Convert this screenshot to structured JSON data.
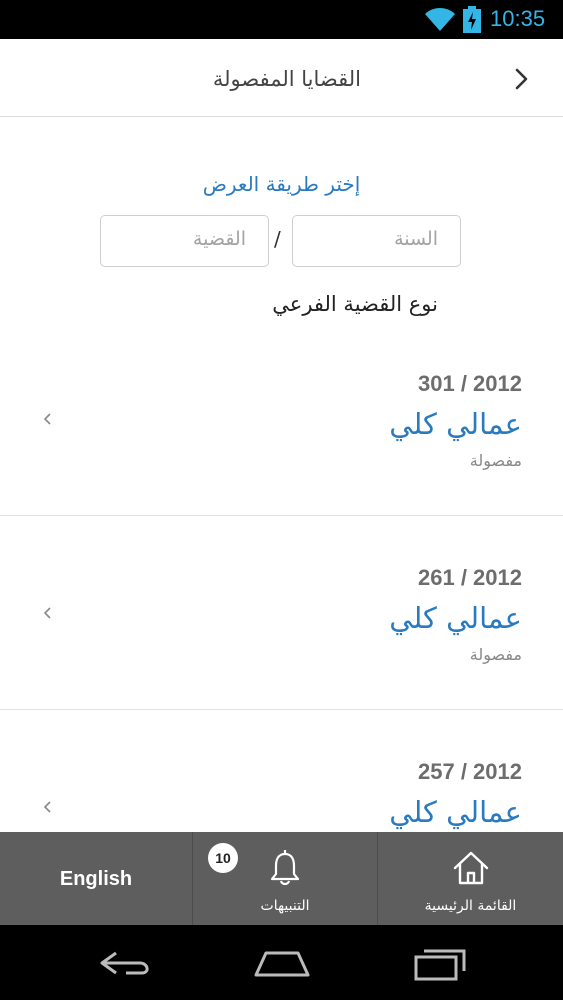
{
  "status_bar": {
    "time": "10:35"
  },
  "header": {
    "title": "القضايا المفصولة"
  },
  "filter": {
    "title": "إختر طريقة العرض",
    "year_placeholder": "السنة",
    "separator": "/",
    "case_placeholder": "القضية",
    "subtype_value": "نوع القضية الفرعي"
  },
  "cases": [
    {
      "number": "301 / 2012",
      "type": "عمالي كلي",
      "status": "مفصولة"
    },
    {
      "number": "261 / 2012",
      "type": "عمالي كلي",
      "status": "مفصولة"
    },
    {
      "number": "257 / 2012",
      "type": "عمالي كلي",
      "status": ""
    }
  ],
  "bottom_nav": {
    "home_label": "القائمة الرئيسية",
    "alerts_label": "التنبيهات",
    "alerts_count": "10",
    "language_label": "English"
  },
  "colors": {
    "accent": "#2a7ac0",
    "nav_background": "#5e5e5e",
    "status_time": "#33b5e5"
  }
}
